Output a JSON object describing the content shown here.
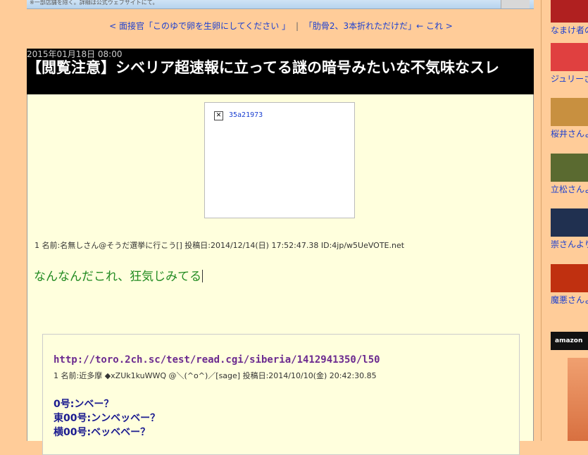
{
  "banner": {
    "text": "※一部店舗を除く。詳細は公式ウェブサイトにて。"
  },
  "nav": {
    "prev_link": "< 面接官「このゆで卵を生卵にしてください 」",
    "separator": "|",
    "next_link": "「肋骨2、3本折れただけだ」← これ >"
  },
  "article": {
    "date": "2015年01月18日 08:00",
    "title": "【閲覧注意】シベリア超速報に立ってる謎の暗号みたいな不気味なスレ",
    "image_alt": "35a21973",
    "post_meta": "1 名前:名無しさん@そうだ選挙に行こう[] 投稿日:2014/12/14(日) 17:52:47.38 ID:4jp/w5UeVOTE.net",
    "post_text": "なんなんだこれ、狂気じみてる"
  },
  "quote": {
    "url": "http://toro.2ch.sc/test/read.cgi/siberia/1412941350/l50",
    "meta": "1 名前:近多摩 ◆xZUk1kuWWQ @＼(^o^)／[sage] 投稿日:2014/10/10(金) 20:42:30.85",
    "lines": [
      "0号:ンベー？",
      "東00号:ンンベッベー？",
      "横00号:ベッベベー？"
    ]
  },
  "sidebar": {
    "items": [
      {
        "label": "なまけ者の",
        "color": "#b02020",
        "icon": "thumbnail-image"
      },
      {
        "label": "ジュリーさ",
        "color": "#e04040",
        "icon": "thumbnail-image"
      },
      {
        "label": "桜井さんよ",
        "color": "#c89040",
        "icon": "thumbnail-image"
      },
      {
        "label": "立松さんよ",
        "color": "#5a6a30",
        "icon": "thumbnail-image"
      },
      {
        "label": "崇さんより",
        "color": "#203050",
        "icon": "thumbnail-image"
      },
      {
        "label": "魔悪さんよ",
        "color": "#c03010",
        "icon": "thumbnail-image"
      }
    ],
    "amazon_label": "amazon"
  }
}
